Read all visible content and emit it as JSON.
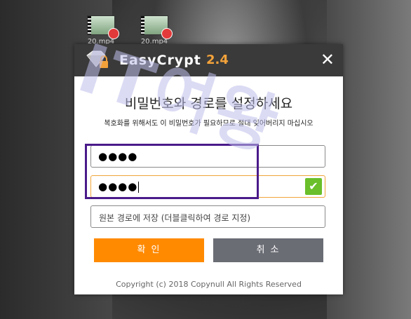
{
  "desktop": {
    "icons": [
      {
        "label": "20.mp4"
      },
      {
        "label": "20.mp4"
      }
    ]
  },
  "dialog": {
    "app_name": "EasyCrypt",
    "app_version": "2.4",
    "heading": "비밀번호와 경로를 설정하세요",
    "subtext": "복호화를 위해서도 이 비밀번호가 필요하므로 절대 잊어버리지 마십시오",
    "password_value": "●●●●",
    "confirm_value": "●●●●",
    "path_placeholder": "원본 경로에 저장 (더블클릭하여 경로 지정)",
    "ok_label": "확 인",
    "cancel_label": "취 소",
    "copyright": "Copyright (c) 2018 Copynull All Rights Reserved"
  },
  "watermark": "IT여왕",
  "colors": {
    "titlebar": "#3a3a3a",
    "accent": "#ff8a00",
    "version": "#f3a23a",
    "cancel": "#6b6d75",
    "check": "#6abf2a",
    "highlight": "#4a1a8a"
  }
}
